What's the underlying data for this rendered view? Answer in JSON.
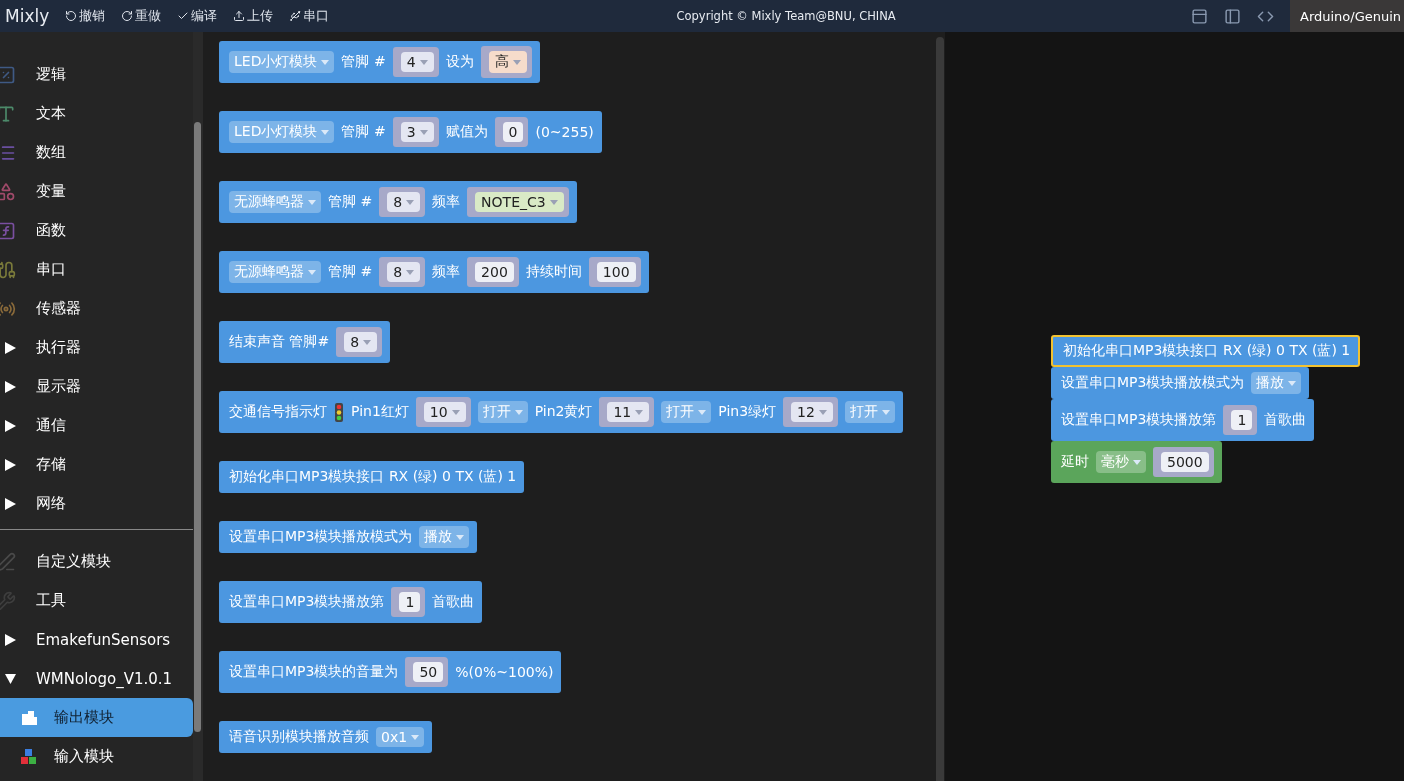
{
  "toolbar": {
    "logo": "Mixly",
    "actions": [
      {
        "kind": "undo",
        "label": "撤销"
      },
      {
        "kind": "redo",
        "label": "重做"
      },
      {
        "kind": "compile",
        "label": "编译"
      },
      {
        "kind": "upload",
        "label": "上传"
      },
      {
        "kind": "serial",
        "label": "串口"
      }
    ],
    "copyright": "Copyright © Mixly Team@BNU, CHINA",
    "board": "Arduino/Genuin"
  },
  "sidebar": {
    "items": [
      {
        "kind": "category",
        "label": "逻辑",
        "color": "#3f5a85",
        "selected": false
      },
      {
        "kind": "category",
        "label": "文本",
        "color": "#4c8a6a",
        "selected": false
      },
      {
        "kind": "category",
        "label": "数组",
        "color": "#6a4fa0",
        "selected": false
      },
      {
        "kind": "category",
        "label": "变量",
        "color": "#a04a6a",
        "selected": false
      },
      {
        "kind": "category",
        "label": "函数",
        "color": "#7a4fa0",
        "selected": false
      },
      {
        "kind": "category",
        "label": "串口",
        "color": "#7a7a3a",
        "selected": false
      },
      {
        "kind": "category",
        "label": "传感器",
        "color": "#8a6a3a",
        "selected": false
      },
      {
        "kind": "folder",
        "label": "执行器",
        "expanded": false,
        "selected": false
      },
      {
        "kind": "folder",
        "label": "显示器",
        "expanded": false,
        "selected": false
      },
      {
        "kind": "folder",
        "label": "通信",
        "expanded": false,
        "selected": false
      },
      {
        "kind": "folder",
        "label": "存储",
        "expanded": false,
        "selected": false
      },
      {
        "kind": "folder",
        "label": "网络",
        "expanded": false,
        "selected": false
      },
      {
        "kind": "divider"
      },
      {
        "kind": "category",
        "label": "自定义模块",
        "color": "#4a4a4a",
        "selected": false
      },
      {
        "kind": "category",
        "label": "工具",
        "color": "#3e3e3e",
        "selected": false
      },
      {
        "kind": "folder",
        "label": "EmakefunSensors",
        "expanded": false,
        "selected": false
      },
      {
        "kind": "folder",
        "label": "WMNologo_V1.0.1",
        "expanded": true,
        "selected": false
      },
      {
        "kind": "module",
        "label": "输出模块",
        "selected": true
      },
      {
        "kind": "module",
        "label": "输入模块",
        "selected": false
      }
    ]
  },
  "palette": {
    "blocks": [
      {
        "color": "#4c97e0",
        "parts": [
          {
            "kind": "dropdown",
            "text": "LED小灯模块"
          },
          {
            "kind": "text",
            "text": "管脚 #"
          },
          {
            "kind": "dropdown-slot",
            "value": "4",
            "color": "#e4e6f2"
          },
          {
            "kind": "text",
            "text": "设为"
          },
          {
            "kind": "dropdown-slot",
            "value": "高",
            "color": "#f6dccb"
          }
        ]
      },
      {
        "color": "#4c97e0",
        "parts": [
          {
            "kind": "dropdown",
            "text": "LED小灯模块"
          },
          {
            "kind": "text",
            "text": "管脚 #"
          },
          {
            "kind": "dropdown-slot",
            "value": "3",
            "color": "#e4e6f2"
          },
          {
            "kind": "text",
            "text": "赋值为"
          },
          {
            "kind": "number-slot",
            "value": "0",
            "color": "#eef0f6"
          },
          {
            "kind": "text",
            "text": "(0~255)"
          }
        ]
      },
      {
        "color": "#4c97e0",
        "parts": [
          {
            "kind": "dropdown",
            "text": "无源蜂鸣器"
          },
          {
            "kind": "text",
            "text": "管脚 #"
          },
          {
            "kind": "dropdown-slot",
            "value": "8",
            "color": "#e4e6f2"
          },
          {
            "kind": "text",
            "text": "频率"
          },
          {
            "kind": "dropdown-slot",
            "value": "NOTE_C3",
            "color": "#d9eac6"
          }
        ]
      },
      {
        "color": "#4c97e0",
        "parts": [
          {
            "kind": "dropdown",
            "text": "无源蜂鸣器"
          },
          {
            "kind": "text",
            "text": "管脚 #"
          },
          {
            "kind": "dropdown-slot",
            "value": "8",
            "color": "#e4e6f2"
          },
          {
            "kind": "text",
            "text": "频率"
          },
          {
            "kind": "number-slot",
            "value": "200",
            "color": "#eef0f6"
          },
          {
            "kind": "text",
            "text": "持续时间"
          },
          {
            "kind": "number-slot",
            "value": "100",
            "color": "#eef0f6"
          }
        ]
      },
      {
        "color": "#4c97e0",
        "parts": [
          {
            "kind": "text",
            "text": "结束声音 管脚#"
          },
          {
            "kind": "dropdown-slot",
            "value": "8",
            "color": "#e4e6f2"
          }
        ]
      },
      {
        "color": "#4c97e0",
        "parts": [
          {
            "kind": "text",
            "text": "交通信号指示灯"
          },
          {
            "kind": "traffic-light"
          },
          {
            "kind": "text",
            "text": "Pin1红灯"
          },
          {
            "kind": "dropdown-slot",
            "value": "10",
            "color": "#e4e6f2"
          },
          {
            "kind": "dropdown",
            "text": "打开"
          },
          {
            "kind": "text",
            "text": "Pin2黄灯"
          },
          {
            "kind": "dropdown-slot",
            "value": "11",
            "color": "#e4e6f2"
          },
          {
            "kind": "dropdown",
            "text": "打开"
          },
          {
            "kind": "text",
            "text": "Pin3绿灯"
          },
          {
            "kind": "dropdown-slot",
            "value": "12",
            "color": "#e4e6f2"
          },
          {
            "kind": "dropdown",
            "text": "打开"
          }
        ]
      },
      {
        "color": "#4c97e0",
        "parts": [
          {
            "kind": "text",
            "text": "初始化串口MP3模块接口 RX (绿) 0 TX (蓝) 1"
          }
        ]
      },
      {
        "color": "#4c97e0",
        "parts": [
          {
            "kind": "text",
            "text": "设置串口MP3模块播放模式为"
          },
          {
            "kind": "dropdown",
            "text": "播放"
          }
        ]
      },
      {
        "color": "#4c97e0",
        "parts": [
          {
            "kind": "text",
            "text": "设置串口MP3模块播放第"
          },
          {
            "kind": "number-slot",
            "value": "1",
            "color": "#eef0f6"
          },
          {
            "kind": "text",
            "text": "首歌曲"
          }
        ]
      },
      {
        "color": "#4c97e0",
        "parts": [
          {
            "kind": "text",
            "text": "设置串口MP3模块的音量为"
          },
          {
            "kind": "number-slot",
            "value": "50",
            "color": "#eef0f6"
          },
          {
            "kind": "text",
            "text": "%(0%~100%)"
          }
        ]
      },
      {
        "color": "#4c97e0",
        "parts": [
          {
            "kind": "text",
            "text": "语音识别模块播放音频"
          },
          {
            "kind": "dropdown",
            "text": "0x1"
          }
        ]
      }
    ]
  },
  "workspace": {
    "blocks": [
      {
        "color": "#4c97e0",
        "selected": true,
        "parts": [
          {
            "kind": "text",
            "text": "初始化串口MP3模块接口 RX (绿) 0 TX (蓝) 1"
          }
        ]
      },
      {
        "color": "#4c97e0",
        "selected": false,
        "parts": [
          {
            "kind": "text",
            "text": "设置串口MP3模块播放模式为"
          },
          {
            "kind": "dropdown",
            "text": "播放"
          }
        ]
      },
      {
        "color": "#4c97e0",
        "selected": false,
        "parts": [
          {
            "kind": "text",
            "text": "设置串口MP3模块播放第"
          },
          {
            "kind": "number-slot",
            "value": "1",
            "color": "#eef0f6"
          },
          {
            "kind": "text",
            "text": "首歌曲"
          }
        ]
      },
      {
        "color": "#5ba55b",
        "selected": false,
        "parts": [
          {
            "kind": "text",
            "text": "延时"
          },
          {
            "kind": "dropdown",
            "text": "毫秒"
          },
          {
            "kind": "number-slot",
            "value": "5000",
            "color": "#eef0f6"
          }
        ]
      }
    ]
  }
}
